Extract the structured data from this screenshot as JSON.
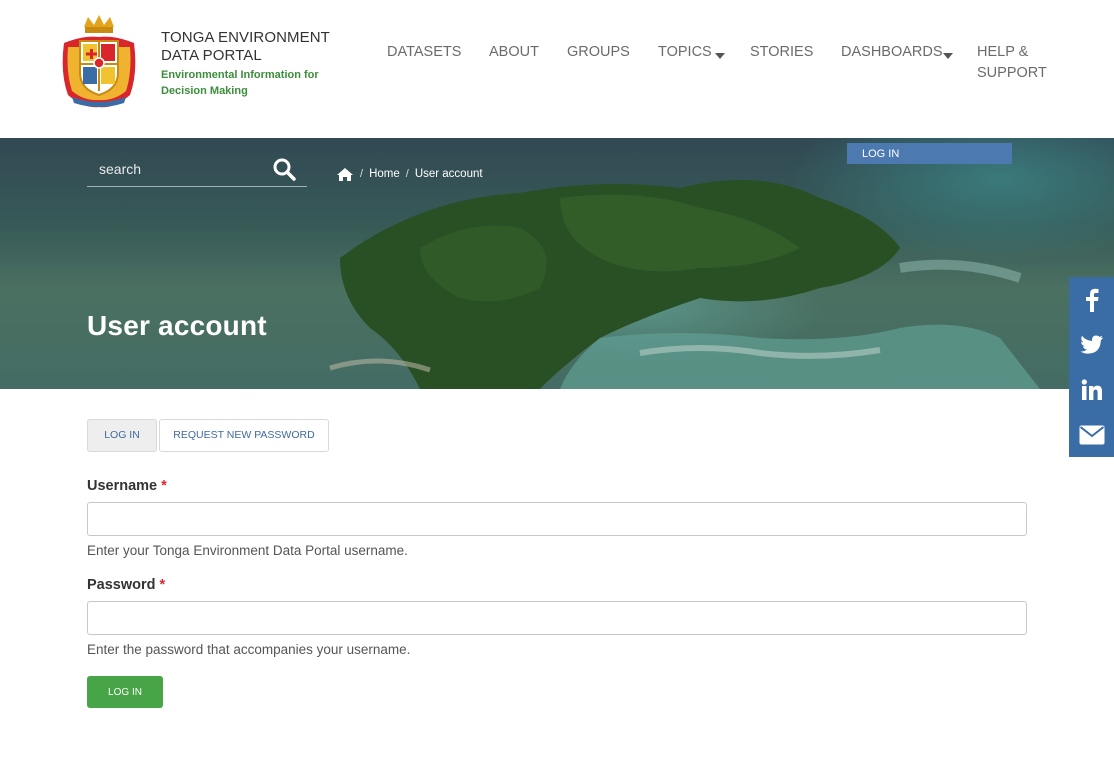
{
  "site": {
    "name": "TONGA ENVIRONMENT DATA PORTAL",
    "slogan": "Environmental Information for Decision Making",
    "logo_icon": "tonga-coat-of-arms-icon"
  },
  "nav": {
    "items": [
      {
        "label": "DATASETS"
      },
      {
        "label": "ABOUT"
      },
      {
        "label": "GROUPS"
      },
      {
        "label": "TOPICS"
      },
      {
        "label": "STORIES"
      },
      {
        "label": "DASHBOARDS"
      },
      {
        "label": "HELP & SUPPORT"
      }
    ]
  },
  "search": {
    "placeholder": "search",
    "icon": "search-icon"
  },
  "breadcrumb": {
    "home_icon": "home-icon",
    "items": [
      "Home",
      "User account"
    ]
  },
  "user_menu": {
    "login_label": "LOG IN"
  },
  "page": {
    "title": "User account"
  },
  "tabs": [
    {
      "label": "LOG IN",
      "active": true
    },
    {
      "label": "REQUEST NEW PASSWORD",
      "active": false
    }
  ],
  "form": {
    "required_marker": "*",
    "username": {
      "label": "Username",
      "value": "",
      "help": "Enter your Tonga Environment Data Portal username."
    },
    "password": {
      "label": "Password",
      "value": "",
      "help": "Enter the password that accompanies your username."
    },
    "submit_label": "LOG IN"
  },
  "social": [
    {
      "icon": "facebook-icon"
    },
    {
      "icon": "twitter-icon"
    },
    {
      "icon": "linkedin-icon"
    },
    {
      "icon": "email-icon"
    }
  ],
  "colors": {
    "accent_blue": "#3a6da5",
    "link_blue": "#3f6aa0",
    "submit_green": "#47a447",
    "slogan_green": "#3b8e3b",
    "required_red": "#e0262e"
  }
}
